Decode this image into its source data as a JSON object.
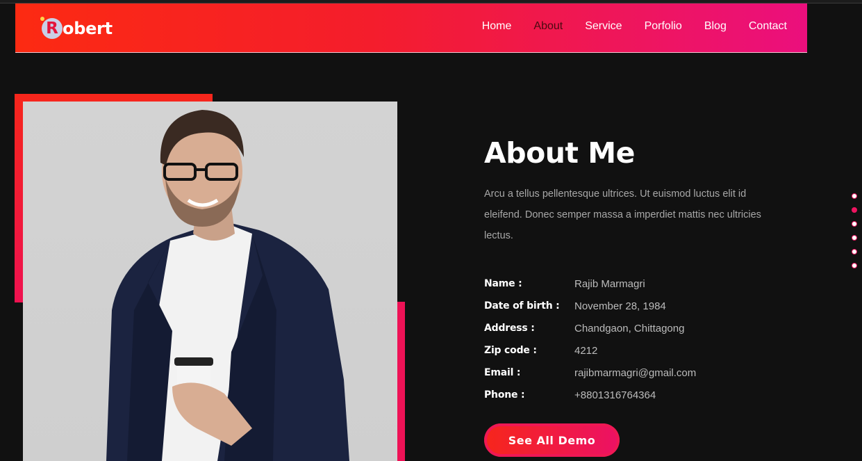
{
  "brand": {
    "badge_letter": "R",
    "name": "obert"
  },
  "nav": {
    "items": [
      {
        "label": "Home",
        "active": false
      },
      {
        "label": "About",
        "active": true
      },
      {
        "label": "Service",
        "active": false
      },
      {
        "label": "Porfolio",
        "active": false
      },
      {
        "label": "Blog",
        "active": false
      },
      {
        "label": "Contact",
        "active": false
      }
    ]
  },
  "about": {
    "title": "About Me",
    "description": "Arcu a tellus pellentesque ultrices. Ut euismod luctus elit id eleifend. Donec semper massa a imperdiet mattis nec ultricies lectus.",
    "info": [
      {
        "label": "Name :",
        "value": "Rajib Marmagri"
      },
      {
        "label": "Date of birth :",
        "value": "November 28, 1984"
      },
      {
        "label": "Address :",
        "value": "Chandgaon, Chittagong"
      },
      {
        "label": "Zip code :",
        "value": "4212"
      },
      {
        "label": "Email :",
        "value": "rajibmarmagri@gmail.com"
      },
      {
        "label": "Phone :",
        "value": "+8801316764364"
      }
    ],
    "button_label": "See All Demo"
  },
  "side_dots": {
    "count": 6,
    "active_index": 1
  },
  "colors": {
    "accent_start": "#f6261b",
    "accent_end": "#ec1165",
    "background": "#111111"
  }
}
